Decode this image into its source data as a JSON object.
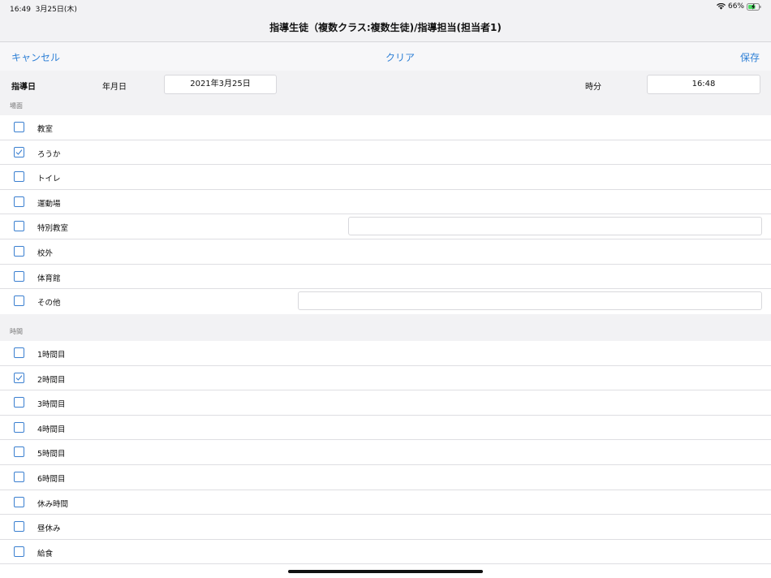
{
  "status": {
    "time": "16:49",
    "date": "3月25日(木)",
    "battery": "66%"
  },
  "title": "指導生徒（複数クラス:複数生徒)/指導担当(担当者1)",
  "toolbar": {
    "cancel": "キャンセル",
    "clear": "クリア",
    "save": "保存"
  },
  "date_row": {
    "label": "指導日",
    "date_label": "年月日",
    "date_value": "2021年3月25日",
    "time_label": "時分",
    "time_value": "16:48"
  },
  "place": {
    "header": "場面",
    "items": [
      {
        "label": "教室",
        "checked": false,
        "has_input": false
      },
      {
        "label": "ろうか",
        "checked": true,
        "has_input": false
      },
      {
        "label": "トイレ",
        "checked": false,
        "has_input": false
      },
      {
        "label": "運動場",
        "checked": false,
        "has_input": false
      },
      {
        "label": "特別教室",
        "checked": false,
        "has_input": true
      },
      {
        "label": "校外",
        "checked": false,
        "has_input": false
      },
      {
        "label": "体育館",
        "checked": false,
        "has_input": false
      },
      {
        "label": "その他",
        "checked": false,
        "has_input": true
      }
    ]
  },
  "period": {
    "header": "時間",
    "items": [
      {
        "label": "1時間目",
        "checked": false
      },
      {
        "label": "2時間目",
        "checked": true
      },
      {
        "label": "3時間目",
        "checked": false
      },
      {
        "label": "4時間目",
        "checked": false
      },
      {
        "label": "5時間目",
        "checked": false
      },
      {
        "label": "6時間目",
        "checked": false
      },
      {
        "label": "休み時間",
        "checked": false
      },
      {
        "label": "昼休み",
        "checked": false
      },
      {
        "label": "給食",
        "checked": false
      }
    ]
  },
  "colors": {
    "accent": "#2f80d6",
    "battery": "#4cd964"
  }
}
